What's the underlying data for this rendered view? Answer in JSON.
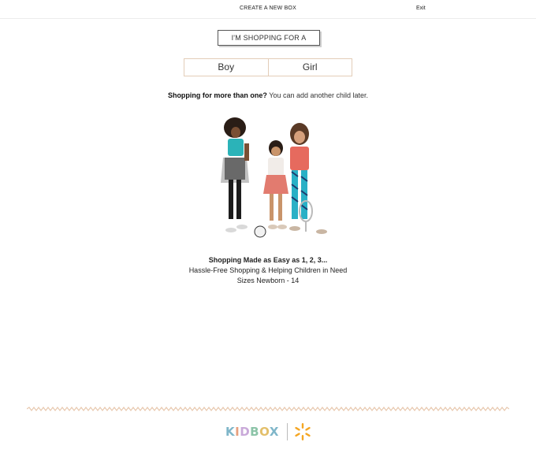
{
  "header": {
    "title": "CREATE A NEW BOX",
    "exit_label": "Exit"
  },
  "shopping_for": {
    "label": "I'M SHOPPING FOR A"
  },
  "gender_options": [
    {
      "label": "Boy"
    },
    {
      "label": "Girl"
    }
  ],
  "more_children": {
    "bold": "Shopping for more than one?",
    "rest": " You can add another child later."
  },
  "tagline": {
    "headline": "Shopping Made as Easy as 1, 2, 3...",
    "line2": "Hassle-Free Shopping & Helping Children in Need",
    "line3": "Sizes Newborn - 14"
  },
  "footer": {
    "brand": [
      "K",
      "I",
      "D",
      "B",
      "O",
      "X"
    ]
  },
  "colors": {
    "accent_border": "#e3cdb8",
    "zigzag": "#e8c9b0",
    "spark": "#f5a623"
  },
  "icons": {
    "hero": "kids-photo",
    "partner": "walmart-spark-icon"
  }
}
